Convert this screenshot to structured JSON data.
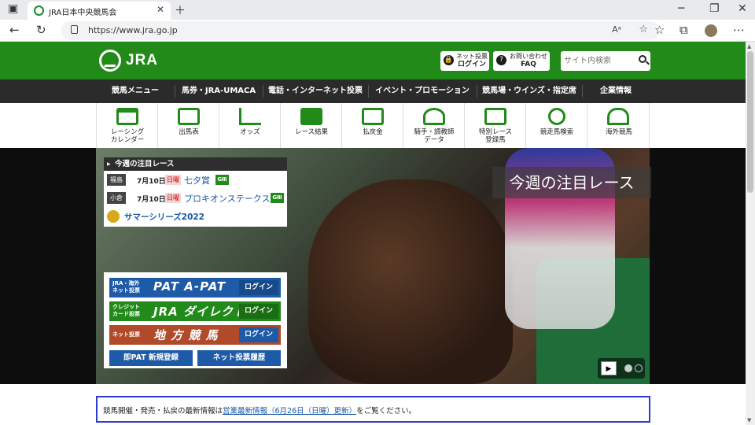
{
  "browser": {
    "tab_title": "JRA日本中央競馬会",
    "url": "https://www.jra.go.jp"
  },
  "header": {
    "logo_text": "JRA",
    "net_login": {
      "line1": "ネット投票",
      "line2": "ログイン"
    },
    "faq": {
      "line1": "お問い合わせ",
      "line2": "FAQ"
    },
    "search_placeholder": "サイト内検索"
  },
  "nav": {
    "items": [
      "競馬メニュー",
      "馬券・JRA-UMACA",
      "電話・インターネット投票",
      "イベント・プロモーション",
      "競馬場・ウインズ・指定席",
      "企業情報"
    ]
  },
  "icon_row": [
    {
      "line1": "レーシング",
      "line2": "カレンダー",
      "icon": "calendar-icon"
    },
    {
      "line1": "出馬表",
      "line2": "",
      "icon": "race-card-icon"
    },
    {
      "line1": "オッズ",
      "line2": "",
      "icon": "odds-chart-icon"
    },
    {
      "line1": "レース結果",
      "line2": "",
      "icon": "podium-icon"
    },
    {
      "line1": "払戻金",
      "line2": "",
      "icon": "money-icon"
    },
    {
      "line1": "騎手・調教師",
      "line2": "データ",
      "icon": "jockey-icon"
    },
    {
      "line1": "特別レース",
      "line2": "登録馬",
      "icon": "special-race-icon"
    },
    {
      "line1": "競走馬検索",
      "line2": "",
      "icon": "horse-search-icon"
    },
    {
      "line1": "海外競馬",
      "line2": "",
      "icon": "overseas-icon"
    }
  ],
  "feature": {
    "overlay_label": "今週の注目レース",
    "box_header": "今週の注目レース",
    "races": [
      {
        "venue": "福島",
        "date": "7月10日",
        "day": "日曜",
        "name": "七夕賞",
        "grade": "GⅢ"
      },
      {
        "venue": "小倉",
        "date": "7月10日",
        "day": "日曜",
        "name": "プロキオンステークス",
        "grade": "GⅢ"
      }
    ],
    "summer_series": "サマーシリーズ2022"
  },
  "pat": {
    "rows": [
      {
        "label_line1": "JRA・海外",
        "label_line2": "ネット投票",
        "main": "PAT  A-PAT",
        "login": "ログイン",
        "color": "#1d5ba8"
      },
      {
        "label_line1": "クレジット",
        "label_line2": "カード投票",
        "main": "JRA ダイレクト",
        "login": "ログイン",
        "color": "#218a19"
      },
      {
        "label_line1": "ネット投票",
        "label_line2": "",
        "main": "地 方 競 馬",
        "login": "ログイン",
        "color": "#b04a2a"
      }
    ],
    "new_reg": "即PAT 新規登録",
    "history": "ネット投票履歴"
  },
  "notice": {
    "prefix": "競馬開催・発売・払戻の最新情報は",
    "link": "営業最新情報（6月26日（日曜）更新）",
    "suffix": "をご覧ください。"
  },
  "colors": {
    "brand_green": "#218a19",
    "nav_dark": "#2b2b2b",
    "link_blue": "#1a57a8",
    "notice_border": "#2c3bd3"
  }
}
